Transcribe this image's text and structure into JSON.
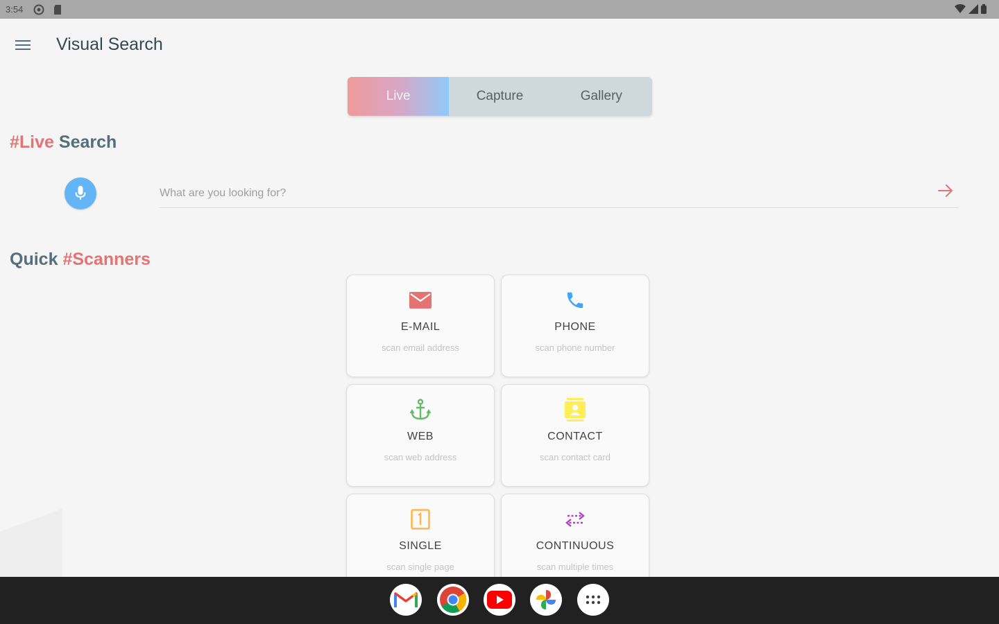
{
  "status_bar": {
    "time": "3:54",
    "left_icons": [
      "settings-icon",
      "sd-card-icon"
    ],
    "right_icons": [
      "wifi-icon",
      "signal-icon",
      "battery-icon"
    ]
  },
  "app_bar": {
    "title": "Visual Search",
    "menu_icon": "hamburger-menu-icon"
  },
  "tabs": [
    {
      "label": "Live",
      "active": true
    },
    {
      "label": "Capture",
      "active": false
    },
    {
      "label": "Gallery",
      "active": false
    }
  ],
  "live_section": {
    "hash_word": "#Live",
    "plain_word": "Search"
  },
  "search": {
    "placeholder": "What are you looking for?",
    "value": "",
    "mic_icon": "microphone-icon",
    "submit_icon": "arrow-right-icon"
  },
  "scanners_section": {
    "plain_word": "Quick",
    "hash_word": "#Scanners"
  },
  "scanners": [
    {
      "title": "E-MAIL",
      "subtitle": "scan email address",
      "icon": "email-icon",
      "color": "#e57373"
    },
    {
      "title": "PHONE",
      "subtitle": "scan phone number",
      "icon": "phone-icon",
      "color": "#42a5f5"
    },
    {
      "title": "WEB",
      "subtitle": "scan web address",
      "icon": "anchor-icon",
      "color": "#66bb6a"
    },
    {
      "title": "CONTACT",
      "subtitle": "scan contact card",
      "icon": "contact-card-icon",
      "color": "#ffee58"
    },
    {
      "title": "SINGLE",
      "subtitle": "scan single page",
      "icon": "single-page-icon",
      "color": "#ffb74d"
    },
    {
      "title": "CONTINUOUS",
      "subtitle": "scan multiple times",
      "icon": "continuous-arrows-icon",
      "color": "#ab47bc"
    }
  ],
  "colors": {
    "accent_red": "#e57373",
    "heading_gray": "#546e7a",
    "mic_blue": "#64b5f6"
  },
  "dock": [
    {
      "app": "Gmail",
      "icon": "gmail-icon"
    },
    {
      "app": "Chrome",
      "icon": "chrome-icon"
    },
    {
      "app": "YouTube",
      "icon": "youtube-icon"
    },
    {
      "app": "Photos",
      "icon": "photos-icon"
    },
    {
      "app": "All apps",
      "icon": "app-drawer-icon"
    }
  ]
}
